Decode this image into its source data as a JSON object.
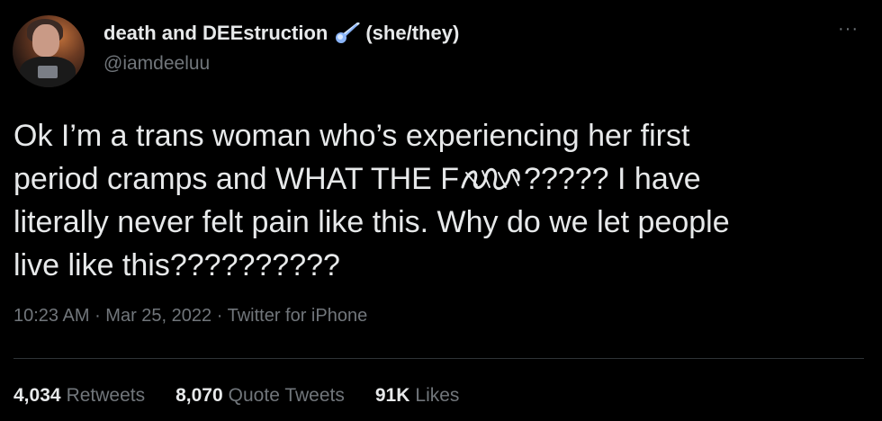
{
  "author": {
    "display_name": "death and DEEstruction",
    "pronouns": "(she/they)",
    "emoji_icon": "comet-icon",
    "handle": "@iamdeeluu"
  },
  "tweet": {
    "line1": "Ok I’m a trans woman who’s experiencing her first",
    "line2_before": "period cramps and WHAT THE F",
    "line2_censored_icon": "scribble-censor-icon",
    "line2_after": "????? I have",
    "line3": "literally never felt pain like this. Why do we let people",
    "line4": "live like this??????????"
  },
  "meta": {
    "time": "10:23 AM",
    "separator": " · ",
    "date": "Mar 25, 2022",
    "source": "Twitter for iPhone"
  },
  "stats": {
    "retweets_count": "4,034",
    "retweets_label": "Retweets",
    "quote_count": "8,070",
    "quote_label": "Quote Tweets",
    "likes_count": "91K",
    "likes_label": "Likes"
  },
  "more_label": "···",
  "colors": {
    "background": "#000000",
    "primary_text": "#e7e9ea",
    "secondary_text": "#71767b",
    "divider": "#2f3336",
    "comet_blue": "#8ab4f8"
  }
}
